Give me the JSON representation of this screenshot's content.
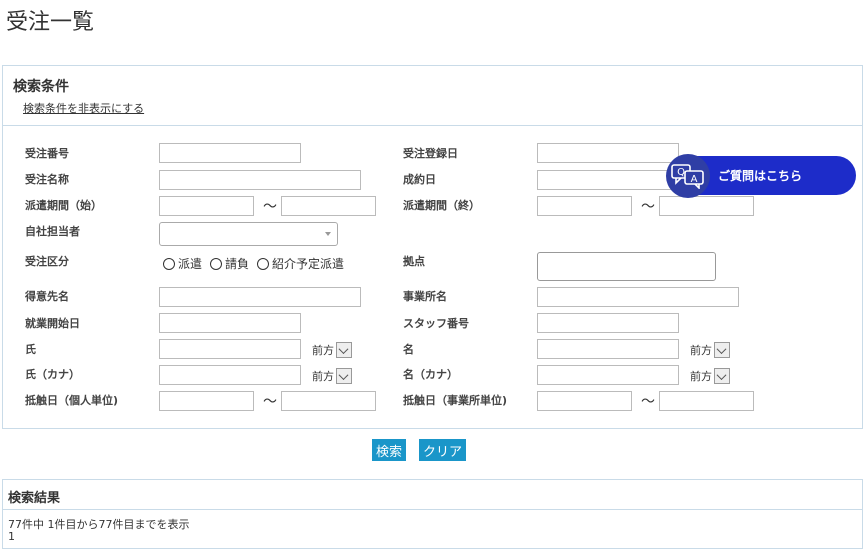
{
  "page": {
    "title": "受注一覧"
  },
  "search": {
    "title": "検索条件",
    "toggle_link": "検索条件を非表示にする",
    "labels": {
      "order_no": "受注番号",
      "order_reg_date": "受注登録日",
      "order_name": "受注名称",
      "contract_date": "成約日",
      "dispatch_start": "派遣期間（始）",
      "dispatch_end": "派遣期間（終）",
      "staff_in_charge": "自社担当者",
      "order_type": "受注区分",
      "base": "拠点",
      "client_name": "得意先名",
      "office_name": "事業所名",
      "work_start_date": "就業開始日",
      "staff_no": "スタッフ番号",
      "last_name": "氏",
      "first_name": "名",
      "last_name_kana": "氏（カナ）",
      "first_name_kana": "名（カナ）",
      "contact_date_person": "抵触日（個人単位)",
      "contact_date_office": "抵触日（事業所単位)"
    },
    "range_sep": "～",
    "match_mode": "前方",
    "order_type_options": [
      "派遣",
      "請負",
      "紹介予定派遣"
    ]
  },
  "buttons": {
    "search": "検索",
    "clear": "クリア"
  },
  "help": {
    "label": "ご質問はこちら"
  },
  "results": {
    "title": "検索結果",
    "summary": "77件中 1件目から77件目までを表示",
    "page": "1"
  }
}
